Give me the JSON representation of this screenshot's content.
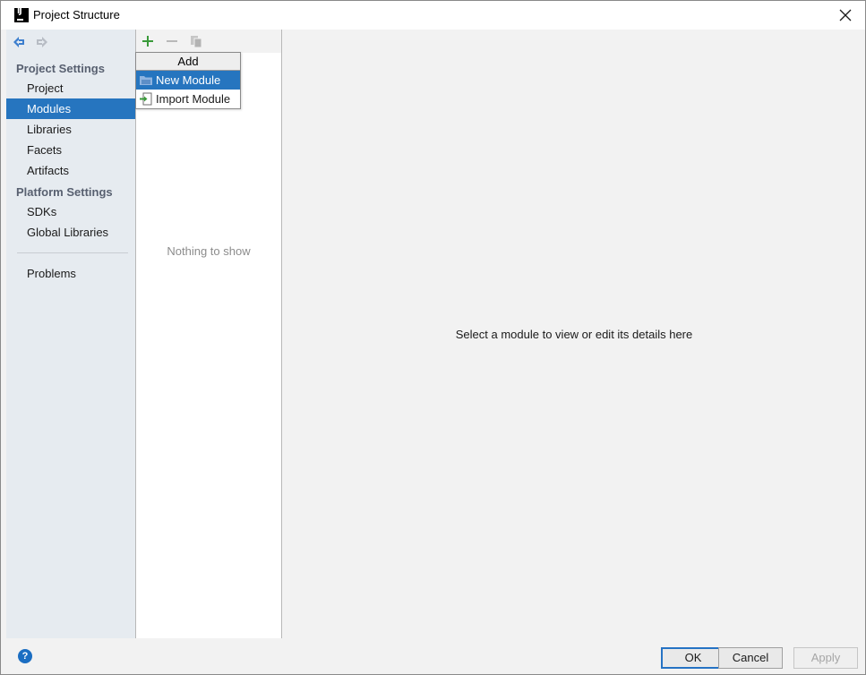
{
  "window": {
    "title": "Project Structure"
  },
  "sidebar": {
    "project_settings_header": "Project Settings",
    "project_items": [
      "Project",
      "Modules",
      "Libraries",
      "Facets",
      "Artifacts"
    ],
    "selected_item": "Modules",
    "platform_settings_header": "Platform Settings",
    "platform_items": [
      "SDKs",
      "Global Libraries"
    ],
    "problems_item": "Problems"
  },
  "middle": {
    "empty_text": "Nothing to show"
  },
  "popup": {
    "header": "Add",
    "items": [
      "New Module",
      "Import Module"
    ],
    "selected_item": "New Module"
  },
  "right": {
    "message": "Select a module to view or edit its details here"
  },
  "buttons": {
    "ok": "OK",
    "cancel": "Cancel",
    "apply": "Apply",
    "help": "?"
  },
  "icons": {
    "title": "intellij-idea-icon",
    "close": "close-icon",
    "back": "arrow-left-icon",
    "forward": "arrow-right-icon",
    "add": "plus-icon",
    "remove": "minus-icon",
    "copy": "copy-icon",
    "new_module": "folder-icon",
    "import_module": "import-icon"
  },
  "colors": {
    "selection": "#2675bf",
    "sidebar_bg": "#e6ebf0",
    "add_icon": "#3a9a3a",
    "back_arrow": "#3d7fce",
    "default_button_border": "#2673c4"
  }
}
